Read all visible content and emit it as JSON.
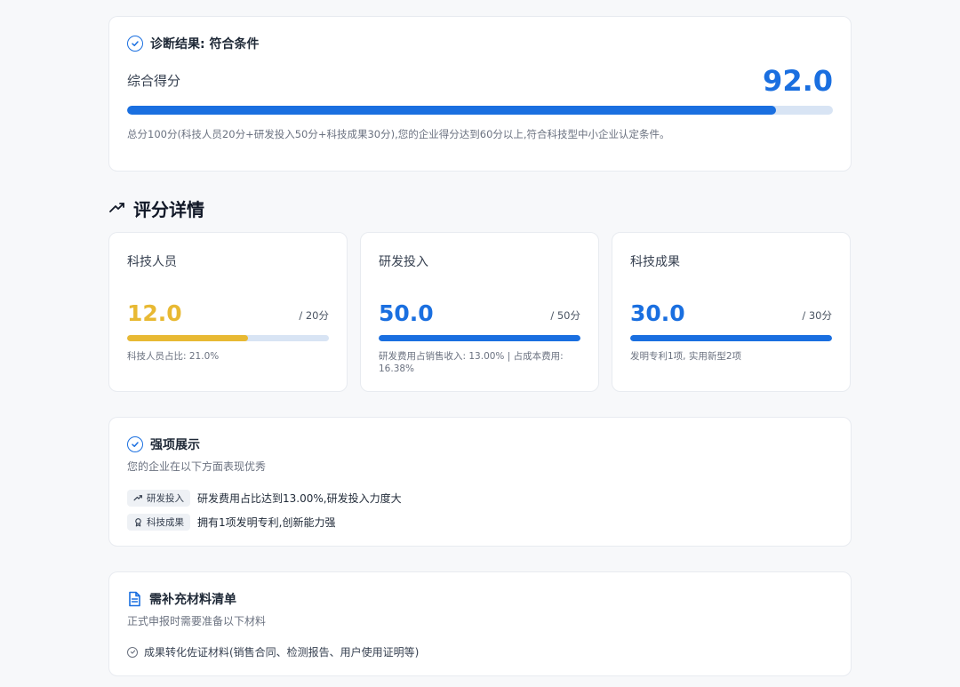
{
  "result": {
    "title": "诊断结果: 符合条件",
    "score_label": "综合得分",
    "score_value": "92.0",
    "score_progress": 0.92,
    "note": "总分100分(科技人员20分+研发投入50分+科技成果30分),您的企业得分达到60分以上,符合科技型中小企业认定条件。"
  },
  "details": {
    "title": "评分详情",
    "metrics": [
      {
        "label": "科技人员",
        "value": "12.0",
        "max": "/ 20分",
        "progress": 0.6,
        "color": "#e8b933",
        "note": "科技人员占比: 21.0%"
      },
      {
        "label": "研发投入",
        "value": "50.0",
        "max": "/ 50分",
        "progress": 1.0,
        "color": "#1a6fe0",
        "note": "研发费用占销售收入: 13.00% | 占成本费用: 16.38%"
      },
      {
        "label": "科技成果",
        "value": "30.0",
        "max": "/ 30分",
        "progress": 1.0,
        "color": "#1a6fe0",
        "note": "发明专利1项, 实用新型2项"
      }
    ]
  },
  "strengths": {
    "title": "强项展示",
    "subtitle": "您的企业在以下方面表现优秀",
    "items": [
      {
        "tag": "研发投入",
        "icon": "trending-up-icon",
        "text": "研发费用占比达到13.00%,研发投入力度大"
      },
      {
        "tag": "科技成果",
        "icon": "award-icon",
        "text": "拥有1项发明专利,创新能力强"
      }
    ]
  },
  "materials": {
    "title": "需补充材料清单",
    "subtitle": "正式申报时需要准备以下材料",
    "items": [
      {
        "text": "成果转化佐证材料(销售合同、检测报告、用户使用证明等)"
      }
    ]
  },
  "colors": {
    "accent": "#1a6fe0",
    "warning": "#e8b933",
    "track": "#d8e4f4"
  }
}
